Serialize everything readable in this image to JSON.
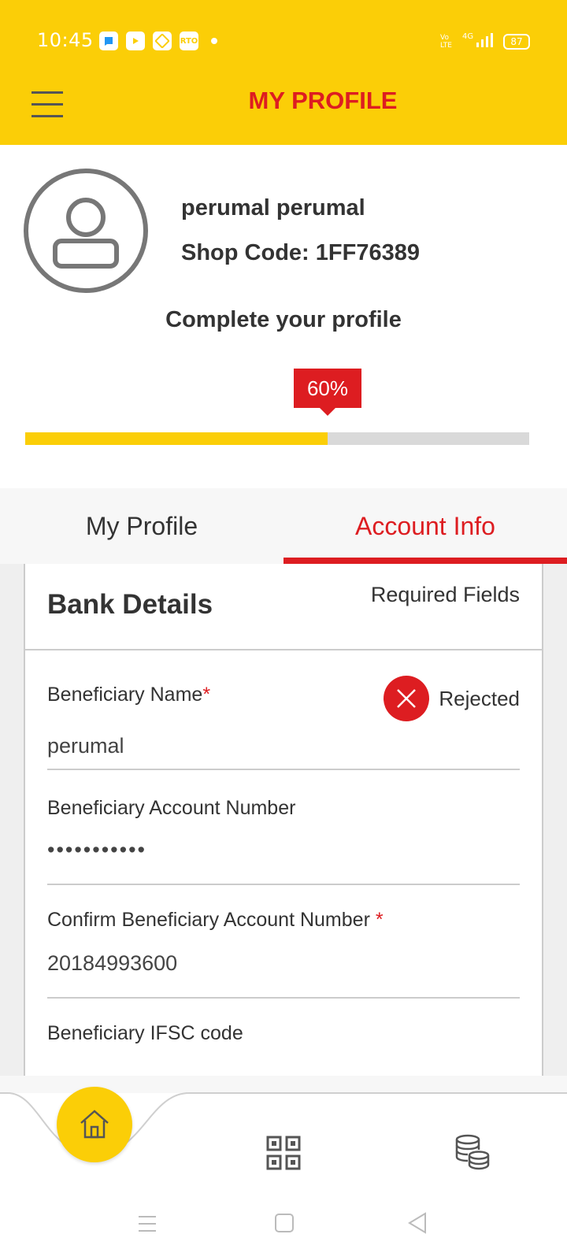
{
  "status_bar": {
    "time": "10:45",
    "apps": [
      "RTO"
    ],
    "network": "4G",
    "battery": "87"
  },
  "header": {
    "title": "MY PROFILE"
  },
  "profile": {
    "name": "perumal perumal",
    "shop_code": "Shop Code: 1FF76389"
  },
  "completion": {
    "title": "Complete your profile",
    "percent_label": "60%",
    "percent": 60
  },
  "tabs": [
    {
      "label": "My Profile",
      "active": false
    },
    {
      "label": "Account Info",
      "active": true
    }
  ],
  "bank_details": {
    "title": "Bank Details",
    "required_note": "Required Fields",
    "fields": [
      {
        "label": "Beneficiary Name",
        "required": "*",
        "value": "perumal",
        "status": "Rejected"
      },
      {
        "label": "Beneficiary Account Number",
        "value": "•••••••••••"
      },
      {
        "label": "Confirm Beneficiary Account Number",
        "required": "*",
        "value": "20184993600"
      },
      {
        "label": "Beneficiary IFSC code"
      }
    ]
  },
  "bottom_nav": {
    "items": [
      "home-icon",
      "qr-code-icon",
      "coins-icon"
    ]
  },
  "colors": {
    "brand_yellow": "#FBCE07",
    "brand_red": "#DD1D21"
  }
}
